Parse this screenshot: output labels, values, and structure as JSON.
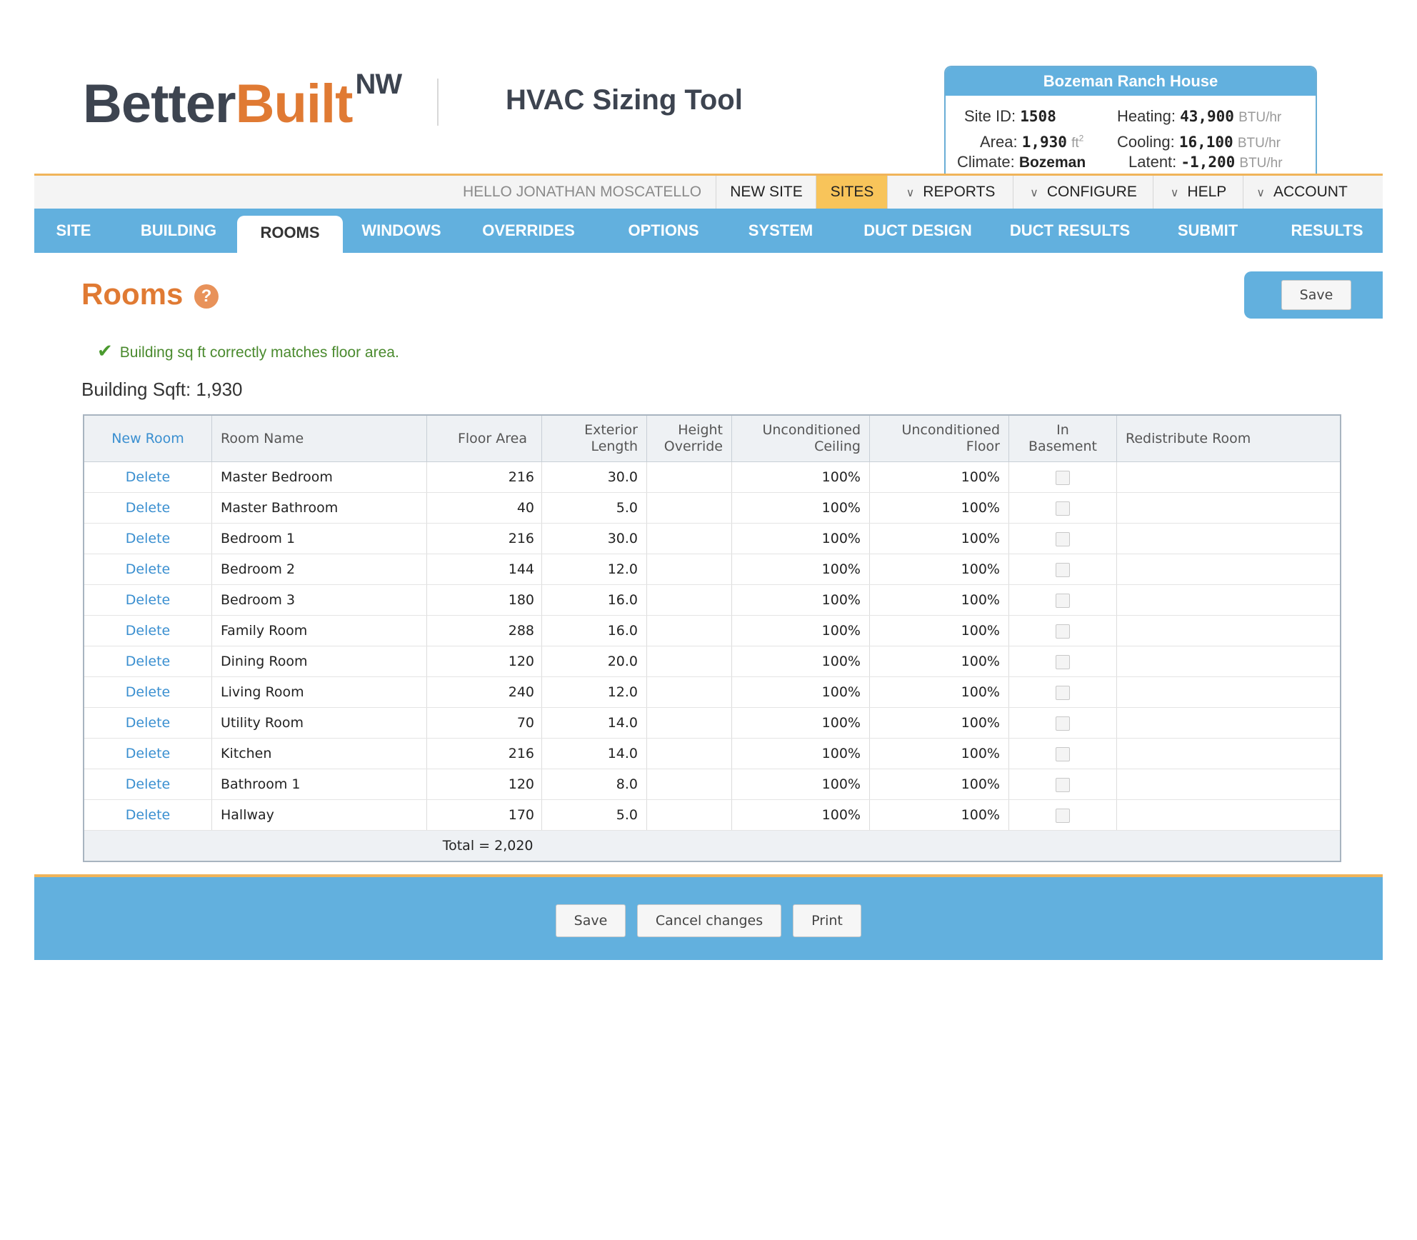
{
  "logo": {
    "better": "Better",
    "built": "Built",
    "sup": "NW"
  },
  "app_title": "HVAC Sizing Tool",
  "site": {
    "title": "Bozeman Ranch House",
    "site_id_label": "Site ID:",
    "site_id": "1508",
    "area_label": "Area:",
    "area": "1,930",
    "area_unit": "ft",
    "climate_label": "Climate:",
    "climate": "Bozeman",
    "heating_label": "Heating:",
    "heating": "43,900",
    "cooling_label": "Cooling:",
    "cooling": "16,100",
    "latent_label": "Latent:",
    "latent": "-1,200",
    "btu_unit": "BTU/hr"
  },
  "top_nav": {
    "hello": "HELLO JONATHAN MOSCATELLO",
    "new_site": "NEW SITE",
    "sites": "SITES",
    "reports": "REPORTS",
    "configure": "CONFIGURE",
    "help": "HELP",
    "account": "ACCOUNT"
  },
  "tabs": [
    "SITE",
    "BUILDING",
    "ROOMS",
    "WINDOWS",
    "OVERRIDES",
    "OPTIONS",
    "SYSTEM",
    "DUCT DESIGN",
    "DUCT RESULTS",
    "SUBMIT",
    "RESULTS"
  ],
  "active_tab": "ROOMS",
  "page_title": "Rooms",
  "help_glyph": "?",
  "save_label": "Save",
  "message": "Building sq ft correctly matches floor area.",
  "building_sqft": "Building Sqft: 1,930",
  "table": {
    "new_room": "New Room",
    "headers": {
      "room_name": "Room Name",
      "floor_area": "Floor Area",
      "exterior_1": "Exterior",
      "exterior_2": "Length",
      "height_1": "Height",
      "height_2": "Override",
      "unc_ceiling_1": "Unconditioned",
      "unc_ceiling_2": "Ceiling",
      "unc_floor_1": "Unconditioned",
      "unc_floor_2": "Floor",
      "basement_1": "In",
      "basement_2": "Basement",
      "redistribute": "Redistribute Room"
    },
    "delete_label": "Delete",
    "rows": [
      {
        "name": "Master Bedroom",
        "area": "216",
        "ext": "30.0",
        "ceil": "100%",
        "floor": "100%",
        "basement": false
      },
      {
        "name": "Master Bathroom",
        "area": "40",
        "ext": "5.0",
        "ceil": "100%",
        "floor": "100%",
        "basement": false
      },
      {
        "name": "Bedroom 1",
        "area": "216",
        "ext": "30.0",
        "ceil": "100%",
        "floor": "100%",
        "basement": false
      },
      {
        "name": "Bedroom 2",
        "area": "144",
        "ext": "12.0",
        "ceil": "100%",
        "floor": "100%",
        "basement": false
      },
      {
        "name": "Bedroom 3",
        "area": "180",
        "ext": "16.0",
        "ceil": "100%",
        "floor": "100%",
        "basement": false
      },
      {
        "name": "Family Room",
        "area": "288",
        "ext": "16.0",
        "ceil": "100%",
        "floor": "100%",
        "basement": false
      },
      {
        "name": "Dining Room",
        "area": "120",
        "ext": "20.0",
        "ceil": "100%",
        "floor": "100%",
        "basement": false
      },
      {
        "name": "Living Room",
        "area": "240",
        "ext": "12.0",
        "ceil": "100%",
        "floor": "100%",
        "basement": false
      },
      {
        "name": "Utility Room",
        "area": "70",
        "ext": "14.0",
        "ceil": "100%",
        "floor": "100%",
        "basement": false
      },
      {
        "name": "Kitchen",
        "area": "216",
        "ext": "14.0",
        "ceil": "100%",
        "floor": "100%",
        "basement": false
      },
      {
        "name": "Bathroom 1",
        "area": "120",
        "ext": "8.0",
        "ceil": "100%",
        "floor": "100%",
        "basement": false
      },
      {
        "name": "Hallway",
        "area": "170",
        "ext": "5.0",
        "ceil": "100%",
        "floor": "100%",
        "basement": false
      }
    ],
    "total": "Total = 2,020"
  },
  "footer": {
    "save": "Save",
    "cancel": "Cancel changes",
    "print": "Print"
  },
  "colors": {
    "accent_blue": "#62b0de",
    "orange": "#e07a33",
    "gold": "#f8c45a",
    "success_green": "#4a8a2e",
    "link_blue": "#3a8fd0"
  }
}
